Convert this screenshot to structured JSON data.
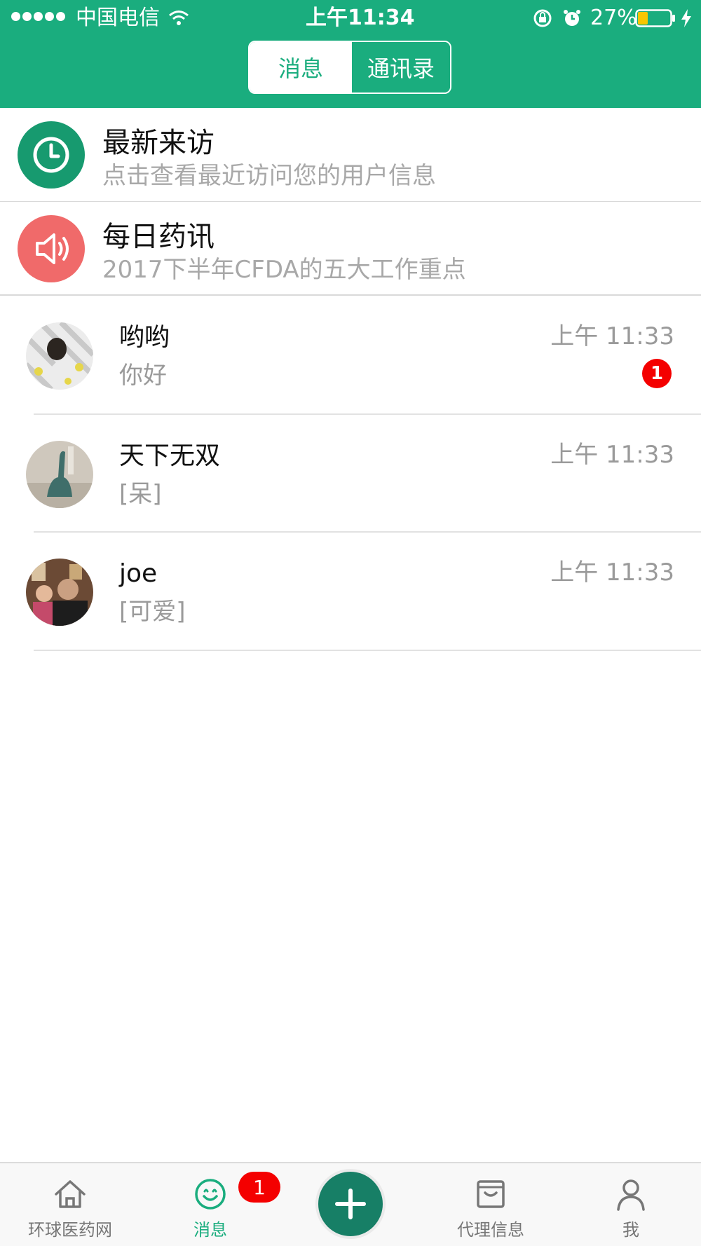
{
  "status_bar": {
    "carrier": "中国电信",
    "time": "上午11:34",
    "battery": "27%"
  },
  "segment": {
    "messages_label": "消息",
    "contacts_label": "通讯录",
    "selected": "消息"
  },
  "features": [
    {
      "title": "最新来访",
      "subtitle": "点击查看最近访问您的用户信息",
      "icon": "clock-icon",
      "color": "#179a6f"
    },
    {
      "title": "每日药讯",
      "subtitle": "2017下半年CFDA的五大工作重点",
      "icon": "speaker-icon",
      "color": "#f06a6a"
    }
  ],
  "chats": [
    {
      "name": "哟哟",
      "message": "你好",
      "time": "上午 11:33",
      "unread": "1"
    },
    {
      "name": "天下无双",
      "message": "[呆]",
      "time": "上午 11:33",
      "unread": ""
    },
    {
      "name": "joe",
      "message": "[可爱]",
      "time": "上午 11:33",
      "unread": ""
    }
  ],
  "tabbar": {
    "home_label": "环球医药网",
    "messages_label": "消息",
    "messages_badge": "1",
    "agency_label": "代理信息",
    "me_label": "我",
    "accent": "#1aad7e"
  }
}
